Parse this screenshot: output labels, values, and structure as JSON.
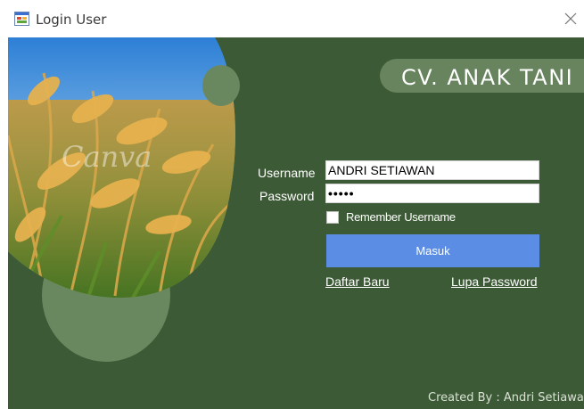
{
  "window": {
    "title": "Login User",
    "icons": {
      "app": "form-app-icon",
      "close": "close-icon"
    }
  },
  "branding": {
    "company_name": "CV. ANAK TANI",
    "watermark": "Canva"
  },
  "form": {
    "username_label": "Username",
    "username_value": "ANDRI SETIAWAN",
    "password_label": "Password",
    "password_value": "•••••",
    "remember_label": "Remember Username",
    "remember_checked": false,
    "login_button": "Masuk",
    "register_link": "Daftar Baru",
    "forgot_link": "Lupa Password"
  },
  "footer": {
    "credit": "Created By : Andri Setiawan"
  },
  "colors": {
    "background": "#3c5a35",
    "accent_circle": "#6a8860",
    "button": "#5b8de4"
  }
}
